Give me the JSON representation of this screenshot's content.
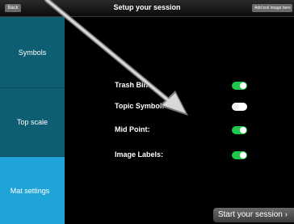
{
  "header": {
    "back_label": "Back",
    "title": "Setup your session",
    "add_label": "Add tool image here"
  },
  "sidebar": {
    "items": [
      {
        "label": "Symbols"
      },
      {
        "label": "Top scale"
      },
      {
        "label": "Mat settings"
      }
    ]
  },
  "settings": [
    {
      "label": "Trash Bin:",
      "state": "on"
    },
    {
      "label": "Topic Symbol:",
      "state": "off"
    },
    {
      "label": "Mid Point:",
      "state": "on"
    },
    {
      "label": "Image Labels:",
      "state": "on"
    }
  ],
  "footer": {
    "start_label": "Start your session"
  },
  "colors": {
    "accent": "#1ea4d6",
    "sidebar": "#0d5e73",
    "toggle_on": "#1fc74a"
  }
}
